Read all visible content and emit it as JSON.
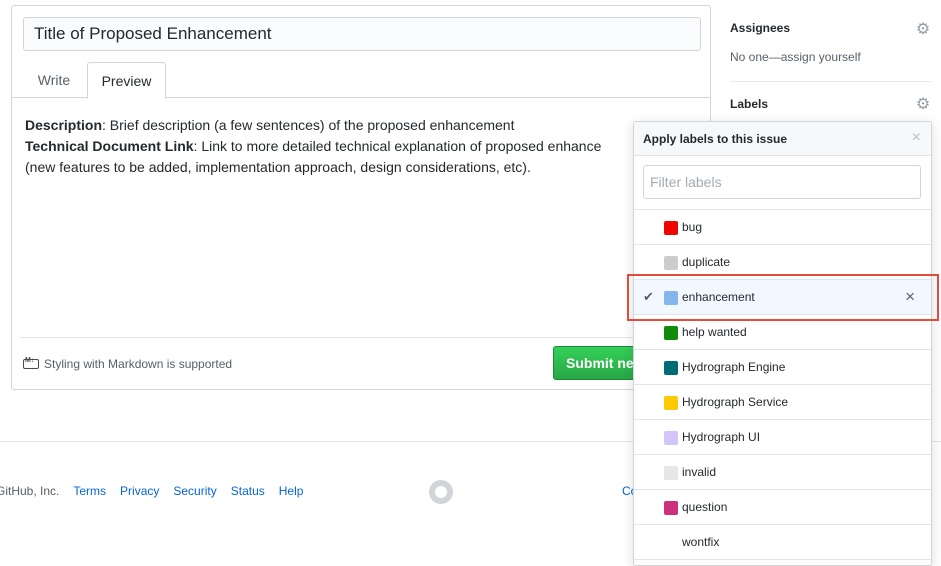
{
  "editor": {
    "title_value": "Title of Proposed Enhancement",
    "tabs": [
      {
        "label": "Write"
      },
      {
        "label": "Preview"
      }
    ],
    "preview": {
      "line1_bold": "Description",
      "line1_rest": ": Brief description (a few sentences) of the proposed enhancement",
      "line2_bold": "Technical Document Link",
      "line2_rest": ": Link to more detailed technical explanation of proposed enhance",
      "line3": "(new features to be added, implementation approach, design considerations, etc)."
    },
    "markdown_note": "Styling with Markdown is supported",
    "submit_label": "Submit ne"
  },
  "sidebar": {
    "assignees_heading": "Assignees",
    "assignees_value": "No one—assign yourself",
    "labels_heading": "Labels"
  },
  "page_footer": {
    "copyright": "GitHub, Inc.",
    "links": [
      "Terms",
      "Privacy",
      "Security",
      "Status",
      "Help"
    ],
    "right_fragment": "Co"
  },
  "labels_popup": {
    "title": "Apply labels to this issue",
    "filter_placeholder": "Filter labels",
    "items": [
      {
        "name": "bug",
        "color": "#ee0701",
        "selected": false
      },
      {
        "name": "duplicate",
        "color": "#cccccc",
        "selected": false
      },
      {
        "name": "enhancement",
        "color": "#84b6eb",
        "selected": true
      },
      {
        "name": "help wanted",
        "color": "#128a0c",
        "selected": false
      },
      {
        "name": "Hydrograph Engine",
        "color": "#006b75",
        "selected": false
      },
      {
        "name": "Hydrograph Service",
        "color": "#fbca04",
        "selected": false
      },
      {
        "name": "Hydrograph UI",
        "color": "#d4c5f9",
        "selected": false
      },
      {
        "name": "invalid",
        "color": "#e6e6e6",
        "selected": false
      },
      {
        "name": "question",
        "color": "#cc317c",
        "selected": false
      },
      {
        "name": "wontfix",
        "color": "#ffffff",
        "selected": false
      }
    ]
  }
}
